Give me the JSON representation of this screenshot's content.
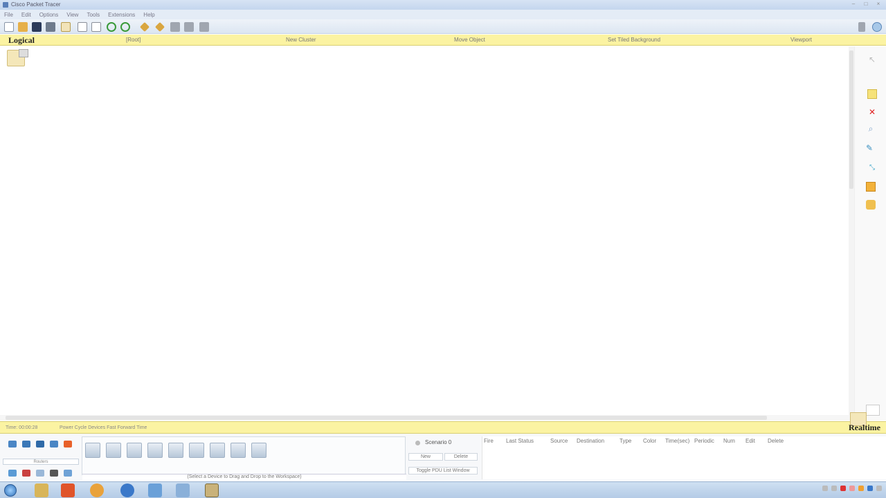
{
  "window": {
    "title": "Cisco Packet Tracer"
  },
  "menu": [
    "File",
    "Edit",
    "Options",
    "View",
    "Tools",
    "Extensions",
    "Help"
  ],
  "toolbar": {
    "icons": [
      "new-file-icon",
      "open-folder-icon",
      "save-icon",
      "print-icon",
      "activity-wizard-icon",
      "document-icon",
      "document-icon",
      "undo-icon",
      "redo-icon",
      "pencil-icon",
      "inspect-icon",
      "zoom-icon",
      "custom-device-icon",
      "palette-icon",
      "info-icon",
      "help-icon"
    ]
  },
  "logical_bar": {
    "title": "Logical",
    "items": [
      "[Root]",
      "New Cluster",
      "Move Object",
      "Set Tiled Background",
      "Viewport"
    ]
  },
  "realtime_bar": {
    "time_label": "Time: 00:00:28",
    "cycle_label": "Power Cycle Devices  Fast Forward Time",
    "mode": "Realtime"
  },
  "bottom": {
    "category_label": "Routers",
    "device_hint": "(Select a Device to Drag and Drop to the Workspace)",
    "scenario": {
      "selected": "Scenario 0",
      "new": "New",
      "delete": "Delete",
      "toggle": "Toggle PDU List Window"
    },
    "event_columns": [
      "Fire",
      "Last Status",
      "Source",
      "Destination",
      "Type",
      "Color",
      "Time(sec)",
      "Periodic",
      "Num",
      "Edit",
      "Delete"
    ]
  },
  "colors": {
    "yellow_bar": "#fbf3a2",
    "toolbar_blue": "#dce6f2",
    "delete_red": "#e02020"
  }
}
